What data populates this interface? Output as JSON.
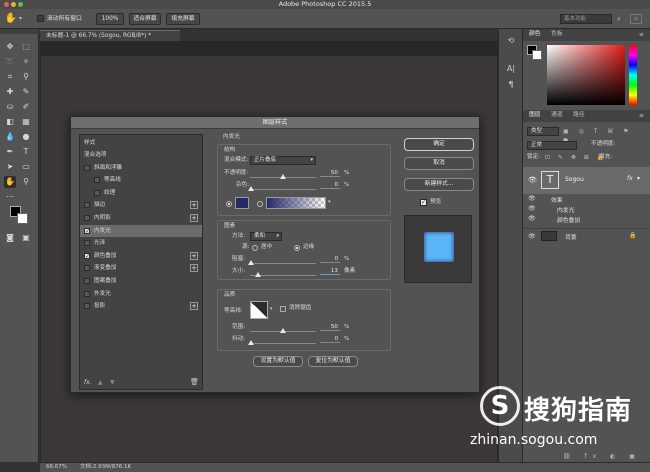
{
  "window": {
    "title": "Adobe Photoshop CC 2015.5"
  },
  "options_bar": {
    "scroll_all_label": "滚动所有窗口",
    "zoom_100": "100%",
    "fit_screen": "适合屏幕",
    "fill_screen": "填充屏幕",
    "workspace": "基本功能"
  },
  "document_tab": {
    "label": "未标题-1 @ 66.7% (Sogou, RGB/8*) *"
  },
  "status": {
    "zoom": "66.67%",
    "doc_size": "文档:2.93M/876.1K"
  },
  "right_panels": {
    "color_tabs": [
      "颜色",
      "色板"
    ],
    "layer_tabs": [
      "图层",
      "通道",
      "路径"
    ],
    "kind_filter": "类型",
    "blend_mode": "正常",
    "opacity_label": "不透明度:",
    "lock_label": "锁定:",
    "fill_label": "填充:",
    "layers": [
      {
        "name": "Sogou",
        "fx": "fx"
      },
      {
        "name": "效果"
      },
      {
        "name": "内发光"
      },
      {
        "name": "颜色叠加"
      },
      {
        "name": "背景"
      }
    ]
  },
  "dialog": {
    "title": "图层样式",
    "styles_header": "样式",
    "style_items": [
      {
        "label": "混合选项",
        "checkbox": false,
        "checked": false,
        "plus": false,
        "selected": false
      },
      {
        "label": "斜面和浮雕",
        "checkbox": true,
        "checked": false,
        "plus": false,
        "selected": false
      },
      {
        "label": "等高线",
        "checkbox": true,
        "checked": false,
        "plus": false,
        "selected": false
      },
      {
        "label": "纹理",
        "checkbox": true,
        "checked": false,
        "plus": false,
        "selected": false
      },
      {
        "label": "描边",
        "checkbox": true,
        "checked": false,
        "plus": true,
        "selected": false
      },
      {
        "label": "内阴影",
        "checkbox": true,
        "checked": false,
        "plus": true,
        "selected": false
      },
      {
        "label": "内发光",
        "checkbox": true,
        "checked": true,
        "plus": false,
        "selected": true
      },
      {
        "label": "光泽",
        "checkbox": true,
        "checked": false,
        "plus": false,
        "selected": false
      },
      {
        "label": "颜色叠加",
        "checkbox": true,
        "checked": true,
        "plus": true,
        "selected": false
      },
      {
        "label": "渐变叠加",
        "checkbox": true,
        "checked": false,
        "plus": true,
        "selected": false
      },
      {
        "label": "图案叠加",
        "checkbox": true,
        "checked": false,
        "plus": false,
        "selected": false
      },
      {
        "label": "外发光",
        "checkbox": true,
        "checked": false,
        "plus": false,
        "selected": false
      },
      {
        "label": "投影",
        "checkbox": true,
        "checked": false,
        "plus": true,
        "selected": false
      }
    ],
    "fx_label": "fx.",
    "inner_glow": {
      "section_title": "内发光",
      "structure": {
        "title": "结构",
        "blend_mode_label": "混合模式:",
        "blend_mode_value": "正片叠底",
        "opacity_label": "不透明度:",
        "opacity_value": "50",
        "noise_label": "杂色:",
        "noise_value": "0",
        "percent": "%"
      },
      "elements": {
        "title": "图素",
        "method_label": "方法:",
        "method_value": "柔和",
        "source_label": "源:",
        "center_label": "居中",
        "edge_label": "边缘",
        "choke_label": "阻塞:",
        "choke_value": "0",
        "size_label": "大小:",
        "size_value": "13",
        "px_unit": "像素",
        "percent": "%"
      },
      "quality": {
        "title": "品质",
        "contour_label": "等高线:",
        "antialias_label": "消除锯齿",
        "range_label": "范围:",
        "range_value": "50",
        "jitter_label": "抖动:",
        "jitter_value": "0",
        "percent": "%"
      },
      "set_default": "设置为默认值",
      "reset_default": "复位为默认值"
    },
    "ok": "确定",
    "cancel": "取消",
    "new_style": "新建样式...",
    "preview_label": "预览",
    "preview_color": "#5ab4f5",
    "glow_color": "#26286a"
  },
  "watermark": {
    "brand": "搜狗指南",
    "url": "zhinan.sogou.com"
  },
  "colors": {
    "ui_dark": "#323232",
    "panel": "#535353",
    "mac_close": "#ec5b53",
    "mac_min": "#e3b341",
    "mac_max": "#5bbf4a"
  }
}
